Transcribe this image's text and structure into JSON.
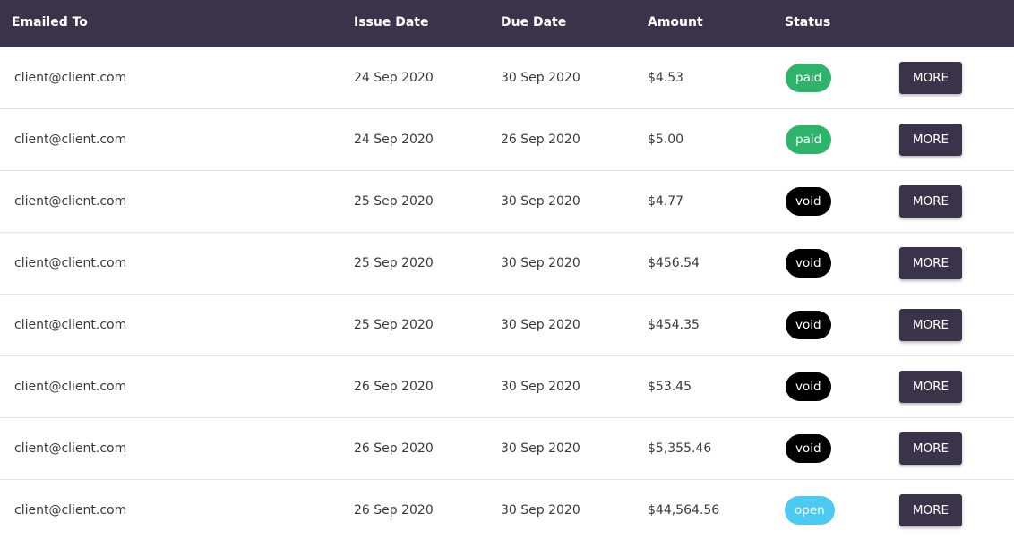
{
  "columns": {
    "emailed_to": "Emailed To",
    "issue_date": "Issue Date",
    "due_date": "Due Date",
    "amount": "Amount",
    "status": "Status"
  },
  "colors": {
    "header_bg": "#3b3349",
    "paid": "#2eb36b",
    "void": "#000000",
    "open": "#4ccbf2",
    "button_bg": "#3b3349"
  },
  "more_label": "MORE",
  "rows": [
    {
      "email": "client@client.com",
      "issue": "24 Sep 2020",
      "due": "30 Sep 2020",
      "amount": "$4.53",
      "status": "paid"
    },
    {
      "email": "client@client.com",
      "issue": "24 Sep 2020",
      "due": "26 Sep 2020",
      "amount": "$5.00",
      "status": "paid"
    },
    {
      "email": "client@client.com",
      "issue": "25 Sep 2020",
      "due": "30 Sep 2020",
      "amount": "$4.77",
      "status": "void"
    },
    {
      "email": "client@client.com",
      "issue": "25 Sep 2020",
      "due": "30 Sep 2020",
      "amount": "$456.54",
      "status": "void"
    },
    {
      "email": "client@client.com",
      "issue": "25 Sep 2020",
      "due": "30 Sep 2020",
      "amount": "$454.35",
      "status": "void"
    },
    {
      "email": "client@client.com",
      "issue": "26 Sep 2020",
      "due": "30 Sep 2020",
      "amount": "$53.45",
      "status": "void"
    },
    {
      "email": "client@client.com",
      "issue": "26 Sep 2020",
      "due": "30 Sep 2020",
      "amount": "$5,355.46",
      "status": "void"
    },
    {
      "email": "client@client.com",
      "issue": "26 Sep 2020",
      "due": "30 Sep 2020",
      "amount": "$44,564.56",
      "status": "open"
    }
  ]
}
